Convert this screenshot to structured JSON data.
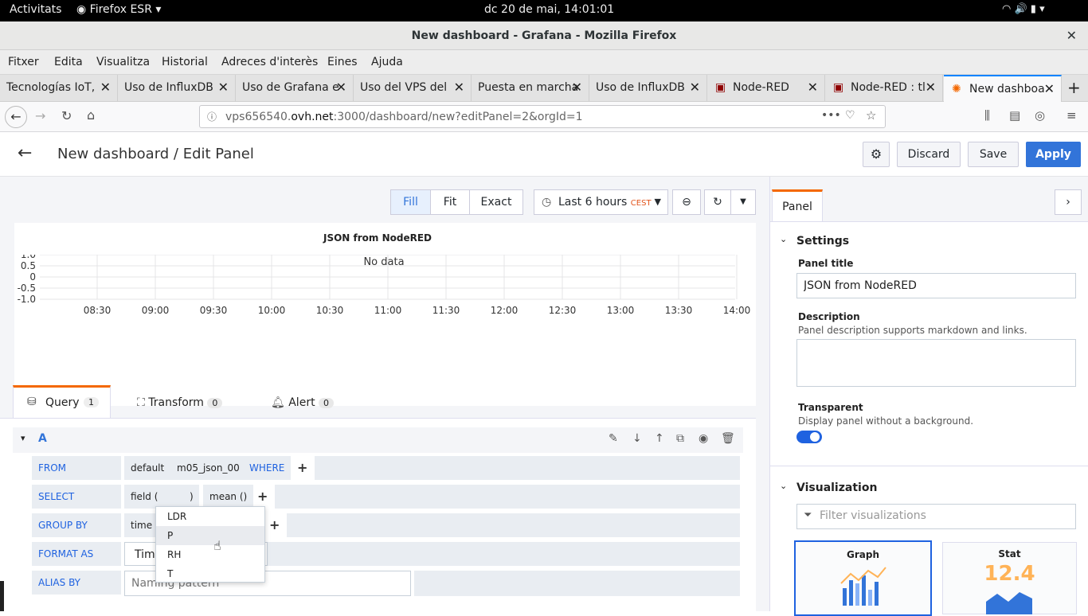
{
  "system": {
    "activities": "Activitats",
    "app_menu": "Firefox ESR",
    "clock": "dc 20 de mai, 14:01:01"
  },
  "window": {
    "title": "New dashboard - Grafana - Mozilla Firefox"
  },
  "menu": [
    "Fitxer",
    "Edita",
    "Visualitza",
    "Historial",
    "Adreces d'interès",
    "Eines",
    "Ajuda"
  ],
  "tabs": [
    {
      "label": "Tecnologías IoT,"
    },
    {
      "label": "Uso de InfluxDB"
    },
    {
      "label": "Uso de Grafana e"
    },
    {
      "label": "Uso del VPS del"
    },
    {
      "label": "Puesta en marcha"
    },
    {
      "label": "Uso de InfluxDB"
    },
    {
      "label": "Node-RED"
    },
    {
      "label": "Node-RED : tl"
    },
    {
      "label": "New dashboa"
    }
  ],
  "url": {
    "host": "vps656540.",
    "domain": "ovh.net",
    "rest": ":3000/dashboard/new?editPanel=2&orgId=1"
  },
  "grafana": {
    "title": "New dashboard / Edit Panel",
    "discard": "Discard",
    "save": "Save",
    "apply": "Apply",
    "fill": "Fill",
    "fit": "Fit",
    "exact": "Exact",
    "time_range": "Last 6 hours",
    "tz": "CEST",
    "panel_title": "JSON from NodeRED",
    "no_data": "No data",
    "y_ticks": [
      "1.0",
      "0.5",
      "0",
      "-0.5",
      "-1.0"
    ],
    "x_ticks": [
      "08:30",
      "09:00",
      "09:30",
      "10:00",
      "10:30",
      "11:00",
      "11:30",
      "12:00",
      "12:30",
      "13:00",
      "13:30",
      "14:00"
    ],
    "query_tab": "Query",
    "query_count": "1",
    "transform_tab": "Transform",
    "transform_count": "0",
    "alert_tab": "Alert",
    "alert_count": "0",
    "query_letter": "A",
    "from_label": "FROM",
    "from_db": "default",
    "from_measure": "m05_json_00",
    "where": "WHERE",
    "select_label": "SELECT",
    "select_field": "field (",
    "select_close": ")",
    "select_mean": "mean ()",
    "groupby_label": "GROUP BY",
    "groupby_time": "time (",
    "formatas_label": "FORMAT AS",
    "formatas_value": "Time",
    "aliasby_label": "ALIAS BY",
    "alias_placeholder": "Naming pattern",
    "dropdown": [
      "LDR",
      "P",
      "RH",
      "T"
    ]
  },
  "options": {
    "panel_tab": "Panel",
    "settings": "Settings",
    "panel_title_label": "Panel title",
    "panel_title_value": "JSON from NodeRED",
    "description_label": "Description",
    "description_help": "Panel description supports markdown and links.",
    "transparent_label": "Transparent",
    "transparent_help": "Display panel without a background.",
    "visualization": "Visualization",
    "filter_placeholder": "Filter visualizations",
    "viz_graph": "Graph",
    "viz_stat": "Stat",
    "stat_value": "12.4"
  },
  "colors": {
    "accent": "#1f62e0",
    "apply": "#3274d9",
    "stat": "#ffb357"
  }
}
